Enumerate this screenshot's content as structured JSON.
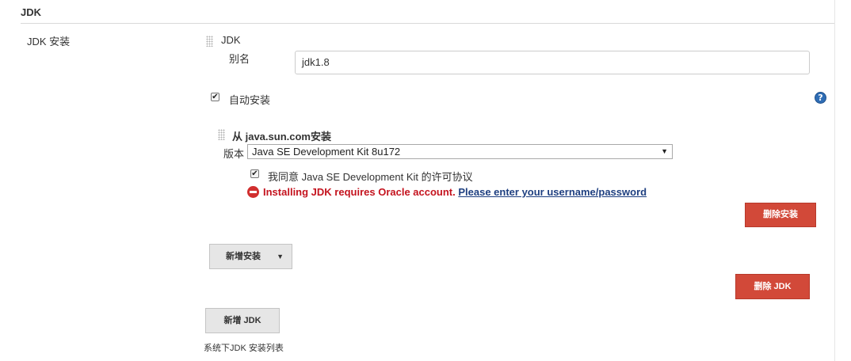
{
  "section": {
    "title": "JDK"
  },
  "left_label": "JDK 安装",
  "installation": {
    "header": "JDK",
    "alias_label": "别名",
    "alias_value": "jdk1.8",
    "auto_install_label": "自动安装",
    "auto_install_checked": true,
    "help_icon": "question-circle-icon",
    "installer": {
      "title": "从 java.sun.com安装",
      "version_label": "版本",
      "version_selected": "Java SE Development Kit 8u172",
      "agree_label": "我同意 Java SE Development Kit 的许可协议",
      "agree_checked": true,
      "error_text": "Installing JDK requires Oracle account. ",
      "error_link": "Please enter your username/password",
      "delete_installer_label": "删除安装"
    },
    "add_installer_label": "新增安装",
    "delete_jdk_label": "删除 JDK"
  },
  "add_jdk_label": "新增 JDK",
  "footnote": "系统下JDK 安装列表",
  "colors": {
    "danger": "#d24939",
    "error_text": "#c4131e",
    "link": "#1e3f80",
    "help": "#2f6db5"
  }
}
